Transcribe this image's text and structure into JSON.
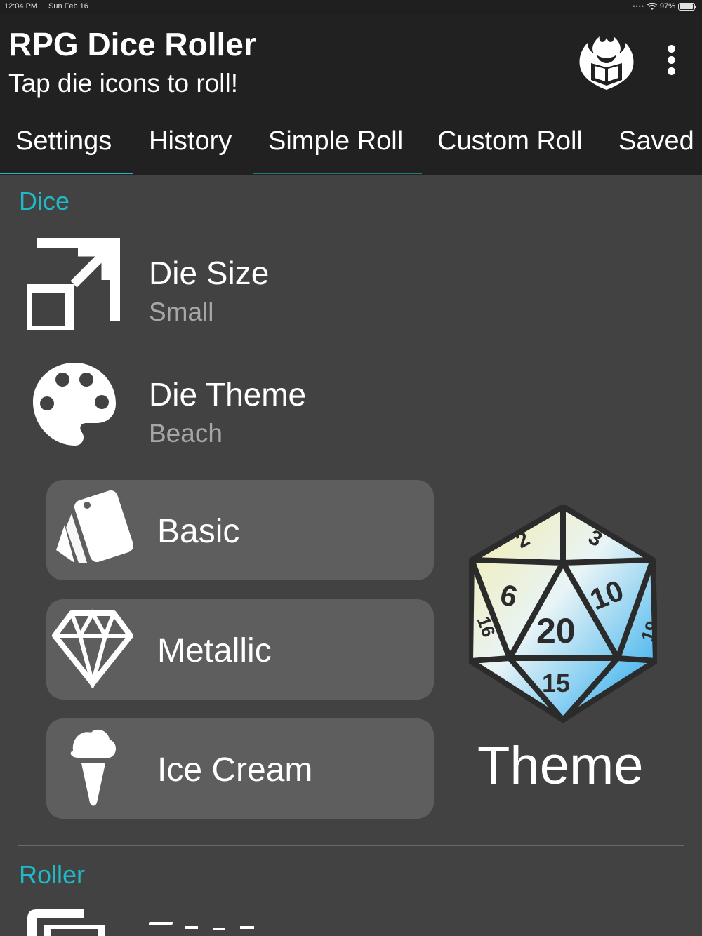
{
  "status_bar": {
    "time": "12:04 PM",
    "date": "Sun Feb 16",
    "battery": "97%",
    "battery_level": 0.97
  },
  "app_bar": {
    "title": "RPG Dice Roller",
    "subtitle": "Tap die icons to roll!",
    "logo_icon": "flaming-book-shield-icon",
    "menu_icon": "more-vert-icon"
  },
  "tabs": [
    {
      "label": "Settings",
      "selected": true
    },
    {
      "label": "History",
      "selected": false
    },
    {
      "label": "Simple Roll",
      "selected": false
    },
    {
      "label": "Custom Roll",
      "selected": false
    },
    {
      "label": "Saved",
      "selected": false
    }
  ],
  "sections": {
    "dice": {
      "title": "Dice",
      "die_size": {
        "title": "Die Size",
        "value": "Small",
        "icon": "resize-icon"
      },
      "die_theme": {
        "title": "Die Theme",
        "value": "Beach",
        "icon": "palette-icon"
      }
    },
    "roller": {
      "title": "Roller",
      "next_item_icon": "animation-icon"
    }
  },
  "theme_options": [
    {
      "label": "Basic",
      "icon": "swatch-cards-icon"
    },
    {
      "label": "Metallic",
      "icon": "diamond-icon"
    },
    {
      "label": "Ice Cream",
      "icon": "ice-cream-icon"
    }
  ],
  "theme_preview": {
    "caption": "Theme",
    "die_numbers": [
      "2",
      "3",
      "6",
      "10",
      "16",
      "20",
      "19",
      "15"
    ],
    "gradient_colors": [
      "#f3e8a0",
      "#2aa9e8"
    ]
  },
  "colors": {
    "accent": "#1fbac8",
    "background": "#424242",
    "app_bar": "#212121",
    "button": "#5e5e5e"
  }
}
